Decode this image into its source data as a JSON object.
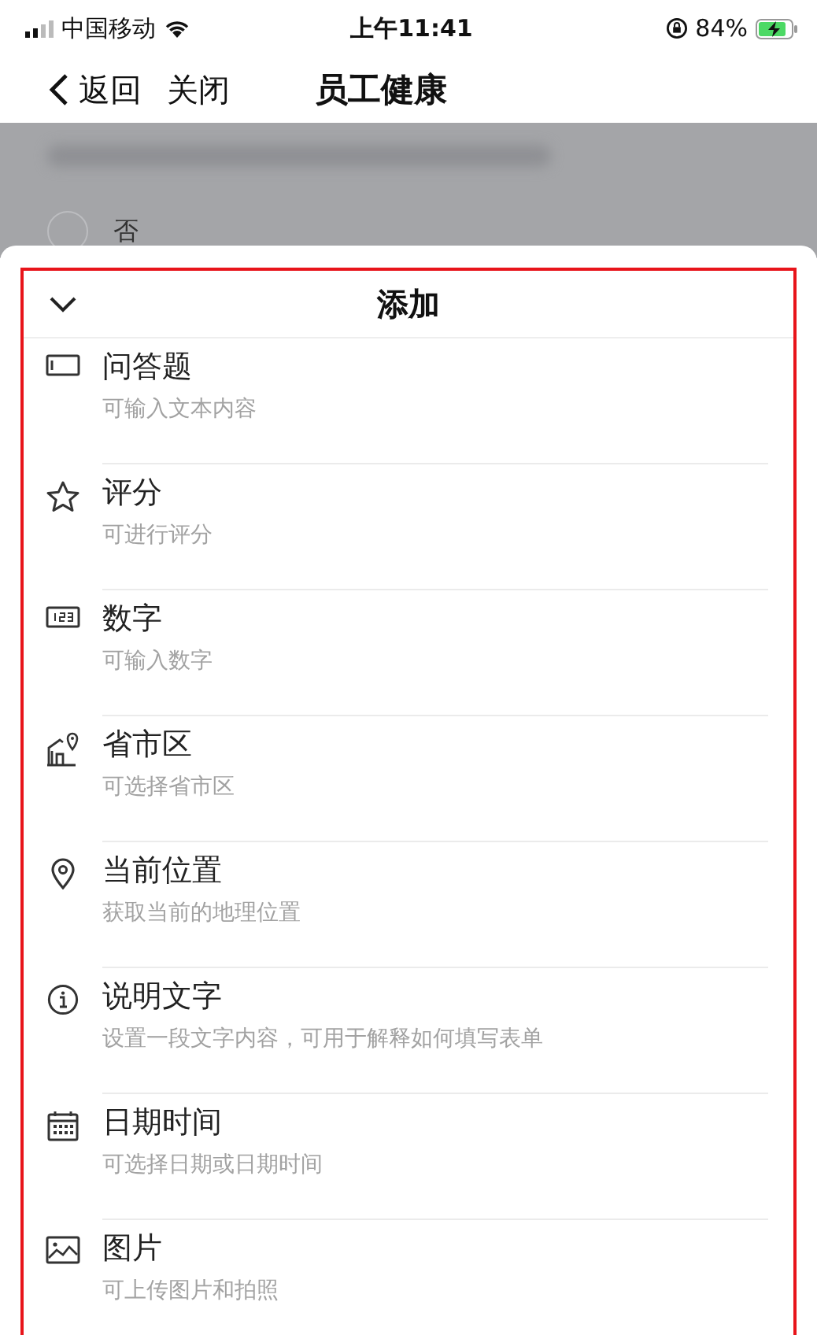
{
  "status_bar": {
    "carrier": "中国移动",
    "time": "上午11:41",
    "battery": "84%"
  },
  "nav": {
    "back": "返回",
    "close": "关闭",
    "title": "员工健康"
  },
  "background": {
    "option": "否"
  },
  "sheet": {
    "title": "添加",
    "items": [
      {
        "kind": "text",
        "title": "问答题",
        "subtitle": "可输入文本内容"
      },
      {
        "kind": "rating",
        "title": "评分",
        "subtitle": "可进行评分"
      },
      {
        "kind": "number",
        "title": "数字",
        "subtitle": "可输入数字"
      },
      {
        "kind": "region",
        "title": "省市区",
        "subtitle": "可选择省市区"
      },
      {
        "kind": "location",
        "title": "当前位置",
        "subtitle": "获取当前的地理位置"
      },
      {
        "kind": "info",
        "title": "说明文字",
        "subtitle": "设置一段文字内容，可用于解释如何填写表单"
      },
      {
        "kind": "datetime",
        "title": "日期时间",
        "subtitle": "可选择日期或日期时间"
      },
      {
        "kind": "image",
        "title": "图片",
        "subtitle": "可上传图片和拍照"
      }
    ]
  }
}
